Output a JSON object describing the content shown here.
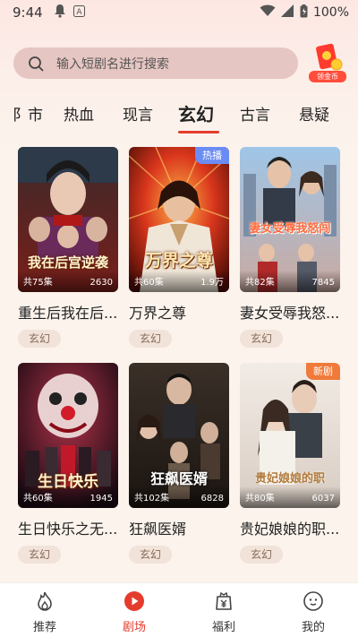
{
  "status_bar": {
    "time": "9:44",
    "battery": "100%"
  },
  "search": {
    "placeholder": "输入短剧名进行搜索",
    "coin_label": "领金币"
  },
  "tabs": [
    {
      "label": "都市",
      "display": "阝市"
    },
    {
      "label": "热血"
    },
    {
      "label": "现言"
    },
    {
      "label": "玄幻"
    },
    {
      "label": "古言"
    },
    {
      "label": "悬疑"
    }
  ],
  "active_tab": "玄幻",
  "colors": {
    "accent": "#e53b2c",
    "badge_blue": "#6b8cf5",
    "badge_orange": "#f07a3a"
  },
  "cards": [
    {
      "title": "重生后我在后...",
      "episodes": "共75集",
      "views": "2630",
      "genre": "玄幻",
      "badge": "",
      "poster_text": "我在后宫逆袭"
    },
    {
      "title": "万界之尊",
      "episodes": "共60集",
      "views": "1.9万",
      "genre": "玄幻",
      "badge": "热播",
      "poster_text": "万界之尊"
    },
    {
      "title": "妻女受辱我怒...",
      "episodes": "共82集",
      "views": "7845",
      "genre": "玄幻",
      "badge": "",
      "poster_text": "妻女受辱我怒闯"
    },
    {
      "title": "生日快乐之无...",
      "episodes": "共60集",
      "views": "1945",
      "genre": "玄幻",
      "badge": "",
      "poster_text": "生日快乐"
    },
    {
      "title": "狂飙医婿",
      "episodes": "共102集",
      "views": "6828",
      "genre": "玄幻",
      "badge": "",
      "poster_text": "狂飙医婿"
    },
    {
      "title": "贵妃娘娘的职...",
      "episodes": "共80集",
      "views": "6037",
      "genre": "玄幻",
      "badge": "新剧",
      "poster_text": "贵妃娘娘的职"
    }
  ],
  "bottom_nav": [
    {
      "label": "推荐",
      "icon": "flame-icon"
    },
    {
      "label": "剧场",
      "icon": "play-icon"
    },
    {
      "label": "福利",
      "icon": "gift-yen-icon"
    },
    {
      "label": "我的",
      "icon": "profile-icon"
    }
  ],
  "active_nav": "剧场"
}
